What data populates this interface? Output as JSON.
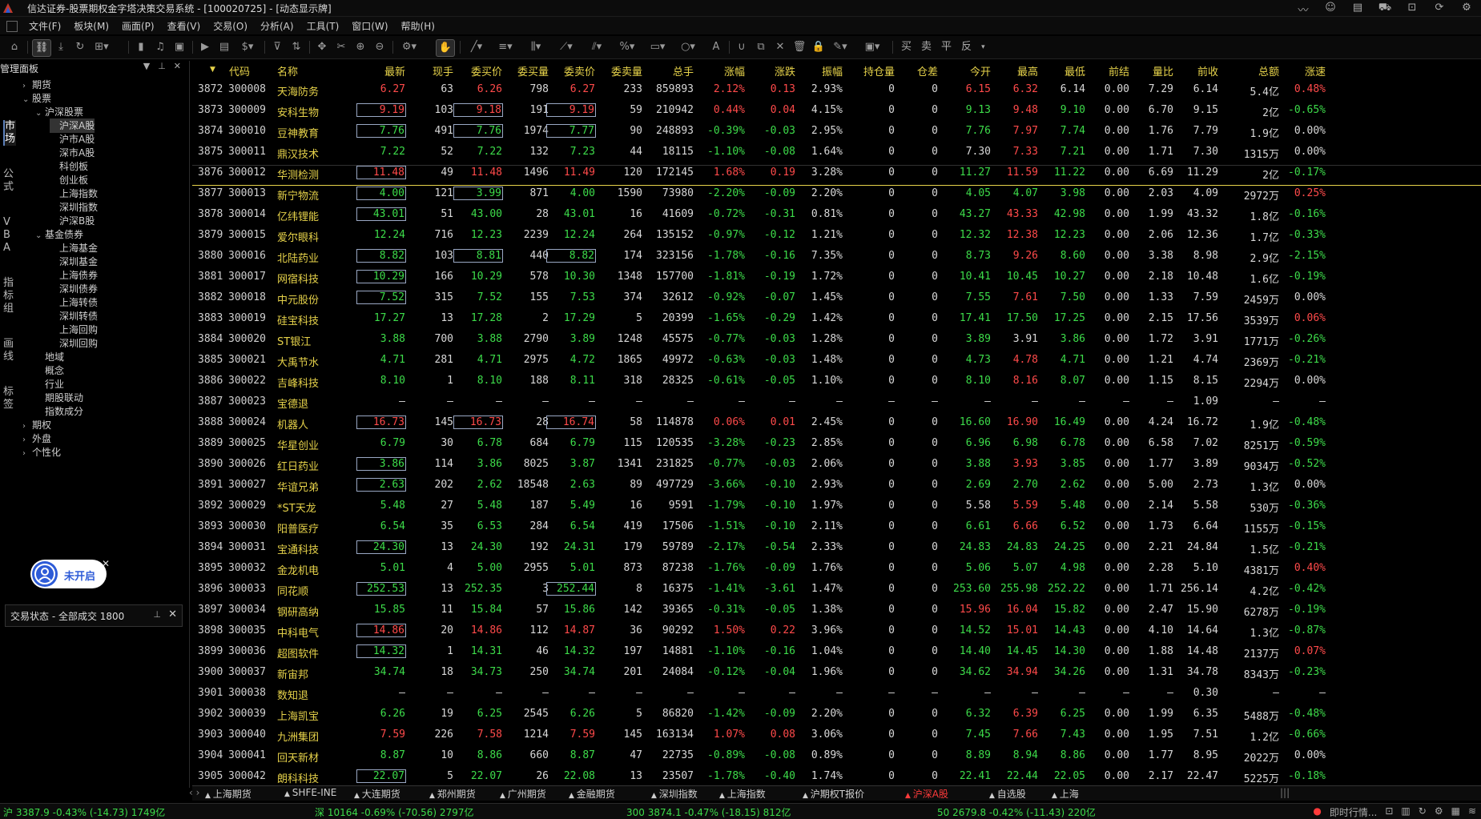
{
  "window": {
    "title": "信达证券-股票期权金字塔决策交易系统 - [100020725] - [动态显示牌]"
  },
  "menu": [
    "文件(F)",
    "板块(M)",
    "画面(P)",
    "查看(V)",
    "交易(O)",
    "分析(A)",
    "工具(T)",
    "窗口(W)",
    "帮助(H)"
  ],
  "toolbar": {
    "trade_buttons": [
      "买",
      "卖",
      "平",
      "反"
    ]
  },
  "side_tabs": [
    "市场",
    "公式",
    "VBA",
    "指标组",
    "画线",
    "标签"
  ],
  "panel": {
    "title": "管理面板",
    "tree": [
      {
        "label": "期货",
        "level": 0,
        "arrow": "right"
      },
      {
        "label": "股票",
        "level": 0,
        "arrow": "down"
      },
      {
        "label": "沪深股票",
        "level": 1,
        "arrow": "down"
      },
      {
        "label": "沪深A股",
        "level": 2,
        "selected": true
      },
      {
        "label": "沪市A股",
        "level": 2
      },
      {
        "label": "深市A股",
        "level": 2
      },
      {
        "label": "科创板",
        "level": 2
      },
      {
        "label": "创业板",
        "level": 2
      },
      {
        "label": "上海指数",
        "level": 2
      },
      {
        "label": "深圳指数",
        "level": 2
      },
      {
        "label": "沪深B股",
        "level": 2
      },
      {
        "label": "基金债券",
        "level": 1,
        "arrow": "down"
      },
      {
        "label": "上海基金",
        "level": 2
      },
      {
        "label": "深圳基金",
        "level": 2
      },
      {
        "label": "上海债券",
        "level": 2
      },
      {
        "label": "深圳债券",
        "level": 2
      },
      {
        "label": "上海转债",
        "level": 2
      },
      {
        "label": "深圳转债",
        "level": 2
      },
      {
        "label": "上海回购",
        "level": 2
      },
      {
        "label": "深圳回购",
        "level": 2
      },
      {
        "label": "地域",
        "level": 1
      },
      {
        "label": "概念",
        "level": 1
      },
      {
        "label": "行业",
        "level": 1
      },
      {
        "label": "期股联动",
        "level": 1
      },
      {
        "label": "指数成分",
        "level": 1
      },
      {
        "label": "期权",
        "level": 0,
        "arrow": "right"
      },
      {
        "label": "外盘",
        "level": 0,
        "arrow": "right"
      },
      {
        "label": "个性化",
        "level": 0,
        "arrow": "right"
      }
    ],
    "bubble_label": "未开启",
    "trade_status": "交易状态 - 全部成交 1800"
  },
  "table": {
    "headers": [
      "代码",
      "名称",
      "最新",
      "现手",
      "委买价",
      "委买量",
      "委卖价",
      "委卖量",
      "总手",
      "涨幅",
      "涨跌",
      "振幅",
      "持仓量",
      "仓差",
      "今开",
      "最高",
      "最低",
      "前结",
      "量比",
      "前收",
      "总额",
      "涨速"
    ],
    "rows": [
      [
        "3872",
        "300008",
        "天海防务",
        "6.27",
        "63",
        "6.26",
        "798",
        "6.27",
        "233",
        "859893",
        "2.12%",
        "0.13",
        "2.93%",
        "0",
        "0",
        "6.15",
        "6.32",
        "6.14",
        "0.00",
        "7.29",
        "6.14",
        "5.4亿",
        "0.48%"
      ],
      [
        "3873",
        "300009",
        "安科生物",
        "9.19",
        "103",
        "9.18",
        "191",
        "9.19",
        "59",
        "210942",
        "0.44%",
        "0.04",
        "4.15%",
        "0",
        "0",
        "9.13",
        "9.48",
        "9.10",
        "0.00",
        "6.70",
        "9.15",
        "2亿",
        "-0.65%"
      ],
      [
        "3874",
        "300010",
        "豆神教育",
        "7.76",
        "491",
        "7.76",
        "1974",
        "7.77",
        "90",
        "248893",
        "-0.39%",
        "-0.03",
        "2.95%",
        "0",
        "0",
        "7.76",
        "7.97",
        "7.74",
        "0.00",
        "1.76",
        "7.79",
        "1.9亿",
        "0.00%"
      ],
      [
        "3875",
        "300011",
        "鼎汉技术",
        "7.22",
        "52",
        "7.22",
        "132",
        "7.23",
        "44",
        "18115",
        "-1.10%",
        "-0.08",
        "1.64%",
        "0",
        "0",
        "7.30",
        "7.33",
        "7.21",
        "0.00",
        "1.71",
        "7.30",
        "1315万",
        "0.00%"
      ],
      [
        "3876",
        "300012",
        "华测检测",
        "11.48",
        "49",
        "11.48",
        "1496",
        "11.49",
        "120",
        "172145",
        "1.68%",
        "0.19",
        "3.28%",
        "0",
        "0",
        "11.27",
        "11.59",
        "11.22",
        "0.00",
        "6.69",
        "11.29",
        "2亿",
        "-0.17%"
      ],
      [
        "3877",
        "300013",
        "新宁物流",
        "4.00",
        "121",
        "3.99",
        "871",
        "4.00",
        "1590",
        "73980",
        "-2.20%",
        "-0.09",
        "2.20%",
        "0",
        "0",
        "4.05",
        "4.07",
        "3.98",
        "0.00",
        "2.03",
        "4.09",
        "2972万",
        "0.25%"
      ],
      [
        "3878",
        "300014",
        "亿纬锂能",
        "43.01",
        "51",
        "43.00",
        "28",
        "43.01",
        "16",
        "41609",
        "-0.72%",
        "-0.31",
        "0.81%",
        "0",
        "0",
        "43.27",
        "43.33",
        "42.98",
        "0.00",
        "1.99",
        "43.32",
        "1.8亿",
        "-0.16%"
      ],
      [
        "3879",
        "300015",
        "爱尔眼科",
        "12.24",
        "716",
        "12.23",
        "2239",
        "12.24",
        "264",
        "135152",
        "-0.97%",
        "-0.12",
        "1.21%",
        "0",
        "0",
        "12.32",
        "12.38",
        "12.23",
        "0.00",
        "2.06",
        "12.36",
        "1.7亿",
        "-0.33%"
      ],
      [
        "3880",
        "300016",
        "北陆药业",
        "8.82",
        "103",
        "8.81",
        "440",
        "8.82",
        "174",
        "323156",
        "-1.78%",
        "-0.16",
        "7.35%",
        "0",
        "0",
        "8.73",
        "9.26",
        "8.60",
        "0.00",
        "3.38",
        "8.98",
        "2.9亿",
        "-2.15%"
      ],
      [
        "3881",
        "300017",
        "网宿科技",
        "10.29",
        "166",
        "10.29",
        "578",
        "10.30",
        "1348",
        "157700",
        "-1.81%",
        "-0.19",
        "1.72%",
        "0",
        "0",
        "10.41",
        "10.45",
        "10.27",
        "0.00",
        "2.18",
        "10.48",
        "1.6亿",
        "-0.19%"
      ],
      [
        "3882",
        "300018",
        "中元股份",
        "7.52",
        "315",
        "7.52",
        "155",
        "7.53",
        "374",
        "32612",
        "-0.92%",
        "-0.07",
        "1.45%",
        "0",
        "0",
        "7.55",
        "7.61",
        "7.50",
        "0.00",
        "1.33",
        "7.59",
        "2459万",
        "0.00%"
      ],
      [
        "3883",
        "300019",
        "硅宝科技",
        "17.27",
        "13",
        "17.28",
        "2",
        "17.29",
        "5",
        "20399",
        "-1.65%",
        "-0.29",
        "1.42%",
        "0",
        "0",
        "17.41",
        "17.50",
        "17.25",
        "0.00",
        "2.15",
        "17.56",
        "3539万",
        "0.06%"
      ],
      [
        "3884",
        "300020",
        "ST银江",
        "3.88",
        "700",
        "3.88",
        "2790",
        "3.89",
        "1248",
        "45575",
        "-0.77%",
        "-0.03",
        "1.28%",
        "0",
        "0",
        "3.89",
        "3.91",
        "3.86",
        "0.00",
        "1.72",
        "3.91",
        "1771万",
        "-0.26%"
      ],
      [
        "3885",
        "300021",
        "大禹节水",
        "4.71",
        "281",
        "4.71",
        "2975",
        "4.72",
        "1865",
        "49972",
        "-0.63%",
        "-0.03",
        "1.48%",
        "0",
        "0",
        "4.73",
        "4.78",
        "4.71",
        "0.00",
        "1.21",
        "4.74",
        "2369万",
        "-0.21%"
      ],
      [
        "3886",
        "300022",
        "吉峰科技",
        "8.10",
        "1",
        "8.10",
        "188",
        "8.11",
        "318",
        "28325",
        "-0.61%",
        "-0.05",
        "1.10%",
        "0",
        "0",
        "8.10",
        "8.16",
        "8.07",
        "0.00",
        "1.15",
        "8.15",
        "2294万",
        "0.00%"
      ],
      [
        "3887",
        "300023",
        "宝德退",
        "—",
        "—",
        "—",
        "—",
        "—",
        "—",
        "—",
        "—",
        "—",
        "—",
        "—",
        "—",
        "—",
        "—",
        "—",
        "—",
        "—",
        "1.09",
        "—",
        "—"
      ],
      [
        "3888",
        "300024",
        "机器人",
        "16.73",
        "145",
        "16.73",
        "28",
        "16.74",
        "58",
        "114878",
        "0.06%",
        "0.01",
        "2.45%",
        "0",
        "0",
        "16.60",
        "16.90",
        "16.49",
        "0.00",
        "4.24",
        "16.72",
        "1.9亿",
        "-0.48%"
      ],
      [
        "3889",
        "300025",
        "华星创业",
        "6.79",
        "30",
        "6.78",
        "684",
        "6.79",
        "115",
        "120535",
        "-3.28%",
        "-0.23",
        "2.85%",
        "0",
        "0",
        "6.96",
        "6.98",
        "6.78",
        "0.00",
        "6.58",
        "7.02",
        "8251万",
        "-0.59%"
      ],
      [
        "3890",
        "300026",
        "红日药业",
        "3.86",
        "114",
        "3.86",
        "8025",
        "3.87",
        "1341",
        "231825",
        "-0.77%",
        "-0.03",
        "2.06%",
        "0",
        "0",
        "3.88",
        "3.93",
        "3.85",
        "0.00",
        "1.77",
        "3.89",
        "9034万",
        "-0.52%"
      ],
      [
        "3891",
        "300027",
        "华谊兄弟",
        "2.63",
        "202",
        "2.62",
        "18548",
        "2.63",
        "89",
        "497729",
        "-3.66%",
        "-0.10",
        "2.93%",
        "0",
        "0",
        "2.69",
        "2.70",
        "2.62",
        "0.00",
        "5.00",
        "2.73",
        "1.3亿",
        "0.00%"
      ],
      [
        "3892",
        "300029",
        "*ST天龙",
        "5.48",
        "27",
        "5.48",
        "187",
        "5.49",
        "16",
        "9591",
        "-1.79%",
        "-0.10",
        "1.97%",
        "0",
        "0",
        "5.58",
        "5.59",
        "5.48",
        "0.00",
        "2.14",
        "5.58",
        "530万",
        "-0.36%"
      ],
      [
        "3893",
        "300030",
        "阳普医疗",
        "6.54",
        "35",
        "6.53",
        "284",
        "6.54",
        "419",
        "17506",
        "-1.51%",
        "-0.10",
        "2.11%",
        "0",
        "0",
        "6.61",
        "6.66",
        "6.52",
        "0.00",
        "1.73",
        "6.64",
        "1155万",
        "-0.15%"
      ],
      [
        "3894",
        "300031",
        "宝通科技",
        "24.30",
        "13",
        "24.30",
        "192",
        "24.31",
        "179",
        "59789",
        "-2.17%",
        "-0.54",
        "2.33%",
        "0",
        "0",
        "24.83",
        "24.83",
        "24.25",
        "0.00",
        "2.21",
        "24.84",
        "1.5亿",
        "-0.21%"
      ],
      [
        "3895",
        "300032",
        "金龙机电",
        "5.01",
        "4",
        "5.00",
        "2955",
        "5.01",
        "873",
        "87238",
        "-1.76%",
        "-0.09",
        "1.76%",
        "0",
        "0",
        "5.06",
        "5.07",
        "4.98",
        "0.00",
        "2.28",
        "5.10",
        "4381万",
        "0.40%"
      ],
      [
        "3896",
        "300033",
        "同花顺",
        "252.53",
        "13",
        "252.35",
        "3",
        "252.44",
        "8",
        "16375",
        "-1.41%",
        "-3.61",
        "1.47%",
        "0",
        "0",
        "253.60",
        "255.98",
        "252.22",
        "0.00",
        "1.71",
        "256.14",
        "4.2亿",
        "-0.42%"
      ],
      [
        "3897",
        "300034",
        "钢研高纳",
        "15.85",
        "11",
        "15.84",
        "57",
        "15.86",
        "142",
        "39365",
        "-0.31%",
        "-0.05",
        "1.38%",
        "0",
        "0",
        "15.96",
        "16.04",
        "15.82",
        "0.00",
        "2.47",
        "15.90",
        "6278万",
        "-0.19%"
      ],
      [
        "3898",
        "300035",
        "中科电气",
        "14.86",
        "20",
        "14.86",
        "112",
        "14.87",
        "36",
        "90292",
        "1.50%",
        "0.22",
        "3.96%",
        "0",
        "0",
        "14.52",
        "15.01",
        "14.43",
        "0.00",
        "4.10",
        "14.64",
        "1.3亿",
        "-0.87%"
      ],
      [
        "3899",
        "300036",
        "超图软件",
        "14.32",
        "1",
        "14.31",
        "46",
        "14.32",
        "197",
        "14881",
        "-1.10%",
        "-0.16",
        "1.04%",
        "0",
        "0",
        "14.40",
        "14.45",
        "14.30",
        "0.00",
        "1.88",
        "14.48",
        "2137万",
        "0.07%"
      ],
      [
        "3900",
        "300037",
        "新宙邦",
        "34.74",
        "18",
        "34.73",
        "250",
        "34.74",
        "201",
        "24084",
        "-0.12%",
        "-0.04",
        "1.96%",
        "0",
        "0",
        "34.62",
        "34.94",
        "34.26",
        "0.00",
        "1.31",
        "34.78",
        "8343万",
        "-0.23%"
      ],
      [
        "3901",
        "300038",
        "数知退",
        "—",
        "—",
        "—",
        "—",
        "—",
        "—",
        "—",
        "—",
        "—",
        "—",
        "—",
        "—",
        "—",
        "—",
        "—",
        "—",
        "—",
        "0.30",
        "—",
        "—"
      ],
      [
        "3902",
        "300039",
        "上海凯宝",
        "6.26",
        "19",
        "6.25",
        "2545",
        "6.26",
        "5",
        "86820",
        "-1.42%",
        "-0.09",
        "2.20%",
        "0",
        "0",
        "6.32",
        "6.39",
        "6.25",
        "0.00",
        "1.99",
        "6.35",
        "5488万",
        "-0.48%"
      ],
      [
        "3903",
        "300040",
        "九洲集团",
        "7.59",
        "226",
        "7.58",
        "1214",
        "7.59",
        "145",
        "163134",
        "1.07%",
        "0.08",
        "3.06%",
        "0",
        "0",
        "7.45",
        "7.66",
        "7.43",
        "0.00",
        "1.95",
        "7.51",
        "1.2亿",
        "-0.66%"
      ],
      [
        "3904",
        "300041",
        "回天新材",
        "8.87",
        "10",
        "8.86",
        "660",
        "8.87",
        "47",
        "22735",
        "-0.89%",
        "-0.08",
        "0.89%",
        "0",
        "0",
        "8.89",
        "8.94",
        "8.86",
        "0.00",
        "1.77",
        "8.95",
        "2022万",
        "0.00%"
      ],
      [
        "3905",
        "300042",
        "朗科科技",
        "22.07",
        "5",
        "22.07",
        "26",
        "22.08",
        "13",
        "23507",
        "-1.78%",
        "-0.40",
        "1.74%",
        "0",
        "0",
        "22.41",
        "22.44",
        "22.05",
        "0.00",
        "2.17",
        "22.47",
        "5225万",
        "-0.18%"
      ]
    ],
    "boxed": {
      "last": [
        "3873",
        "3874",
        "3876",
        "3877",
        "3878",
        "3880",
        "3881",
        "3882",
        "3888",
        "3890",
        "3891",
        "3894",
        "3896",
        "3898",
        "3899",
        "3905"
      ],
      "bid": [
        "3873",
        "3874",
        "3877",
        "3880",
        "3888"
      ],
      "ask": [
        "3873",
        "3874",
        "3880",
        "3888",
        "3896"
      ]
    }
  },
  "bottom_tabs": [
    {
      "label": "上海期货"
    },
    {
      "label": "SHFE-INE"
    },
    {
      "label": "大连期货"
    },
    {
      "label": "郑州期货"
    },
    {
      "label": "广州期货"
    },
    {
      "label": "金融期货"
    },
    {
      "label": "深圳指数"
    },
    {
      "label": "上海指数"
    },
    {
      "label": "沪期权T报价"
    },
    {
      "label": "沪深A股",
      "active": true
    },
    {
      "label": "自选股"
    },
    {
      "label": "上海"
    }
  ],
  "status": {
    "sh": "沪 3387.9 -0.43% (-14.73) 1749亿",
    "sz": "深 10164 -0.69% (-70.56) 2797亿",
    "hs300": "300 3874.1 -0.47% (-18.15) 812亿",
    "sz50": "50 2679.8 -0.42% (-11.43) 220亿",
    "news": "即时行情..."
  },
  "colors": {
    "up": "#ff4a4a",
    "down": "#3ddc4a",
    "header": "#e6d24a",
    "name": "#e6d24a"
  }
}
